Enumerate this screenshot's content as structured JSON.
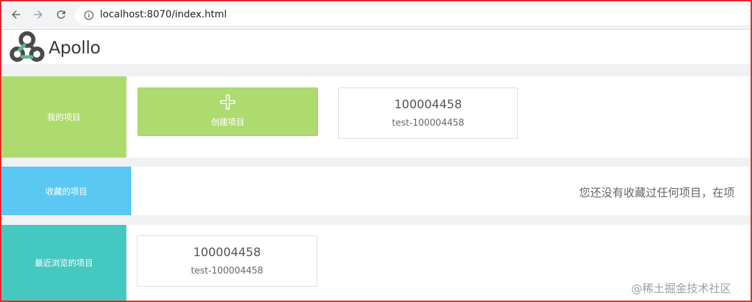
{
  "browser": {
    "url": "localhost:8070/index.html",
    "back_icon": "arrow-left-icon",
    "forward_icon": "arrow-right-icon",
    "reload_icon": "reload-icon",
    "info_icon": "info-icon"
  },
  "app": {
    "logo_text": "Apollo",
    "logo_icon": "apollo-logo-icon"
  },
  "sections": {
    "my_projects": {
      "label": "我的项目",
      "color": "#aedb6f",
      "create_label": "创建项目",
      "projects": [
        {
          "id": "100004458",
          "name": "test-100004458"
        }
      ]
    },
    "favorites": {
      "label": "收藏的项目",
      "color": "#5bc8f4",
      "empty_message": "您还没有收藏过任何项目，在项"
    },
    "recent": {
      "label": "最近浏览的项目",
      "color": "#45c8bf",
      "projects": [
        {
          "id": "100004458",
          "name": "test-100004458"
        }
      ]
    }
  },
  "watermark": "@稀土掘金技术社区"
}
